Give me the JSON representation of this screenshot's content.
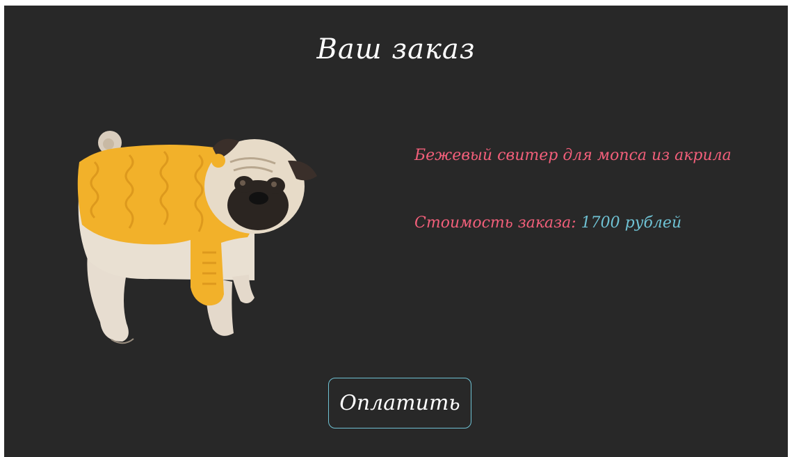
{
  "order": {
    "title": "Ваш заказ",
    "product_name": "Бежевый свитер для мопса из акрила",
    "price_label": "Стоимость заказа:",
    "price_value": "1700 рублей",
    "pay_button_label": "Оплатить"
  },
  "colors": {
    "background": "#282828",
    "accent": "#f25f7a",
    "value": "#6fc2d4",
    "button_border": "#6fc2d4",
    "sweater": "#f2b12a"
  },
  "image": {
    "icon": "pug-in-sweater-photo"
  }
}
